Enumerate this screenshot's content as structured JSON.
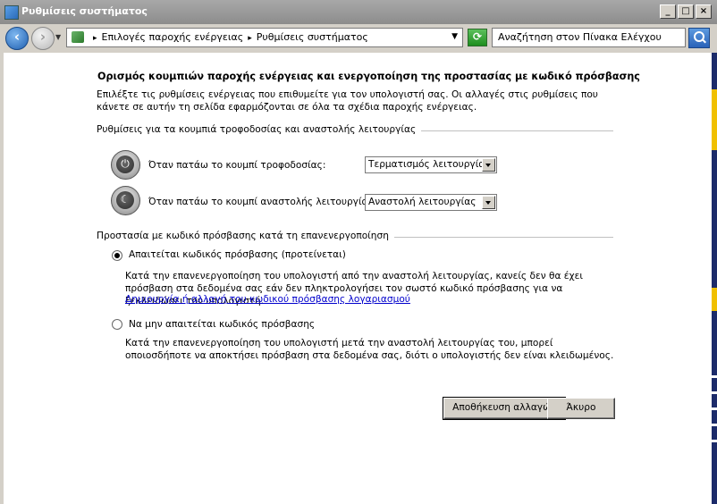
{
  "window": {
    "title": "Ρυθμίσεις συστήματος",
    "minimize": "_",
    "maximize": "□",
    "close": "×"
  },
  "addressbar": {
    "crumbs": [
      "Επιλογές παροχής ενέργειας",
      "Ρυθμίσεις συστήματος"
    ],
    "search_placeholder": "Αναζήτηση στον Πίνακα Ελέγχου"
  },
  "page": {
    "heading": "Ορισμός κουμπιών παροχής ενέργειας και ενεργοποίηση της προστασίας με κωδικό πρόσβασης",
    "intro": "Επιλέξτε τις ρυθμίσεις ενέργειας που επιθυμείτε για τον υπολογιστή σας. Οι αλλαγές στις ρυθμίσεις που κάνετε σε αυτήν τη σελίδα εφαρμόζονται σε όλα τα σχέδια παροχής ενέργειας.",
    "group_buttons": "Ρυθμίσεις για τα κουμπιά τροφοδοσίας και αναστολής λειτουργίας",
    "power_label": "Όταν πατάω το κουμπί τροφοδοσίας:",
    "power_value": "Τερματισμός λειτουργίας",
    "sleep_label": "Όταν πατάω το κουμπί αναστολής λειτουργίας:",
    "sleep_value": "Αναστολή λειτουργίας",
    "group_password": "Προστασία με κωδικό πρόσβασης κατά τη επανενεργοποίηση",
    "opt_require": "Απαιτείται κωδικός πρόσβασης (προτείνεται)",
    "opt_require_desc": "Κατά την επανενεργοποίηση του υπολογιστή από την αναστολή λειτουργίας, κανείς δεν θα έχει πρόσβαση στα δεδομένα σας εάν δεν πληκτρολογήσει τον σωστό κωδικό πρόσβασης για να ξεκλειδώσει τον υπολογιστή.",
    "opt_require_link": "Δημιουργία ή αλλαγή του κωδικού πρόσβασης λογαριασμού",
    "opt_norequire": "Να μην απαιτείται κωδικός πρόσβασης",
    "opt_norequire_desc": "Κατά την επανενεργοποίηση του υπολογιστή μετά την αναστολή λειτουργίας του, μπορεί οποιοσδήποτε να αποκτήσει πρόσβαση στα δεδομένα σας, διότι ο υπολογιστής δεν είναι κλειδωμένος.",
    "save": "Αποθήκευση αλλαγών",
    "cancel": "Άκυρο"
  }
}
